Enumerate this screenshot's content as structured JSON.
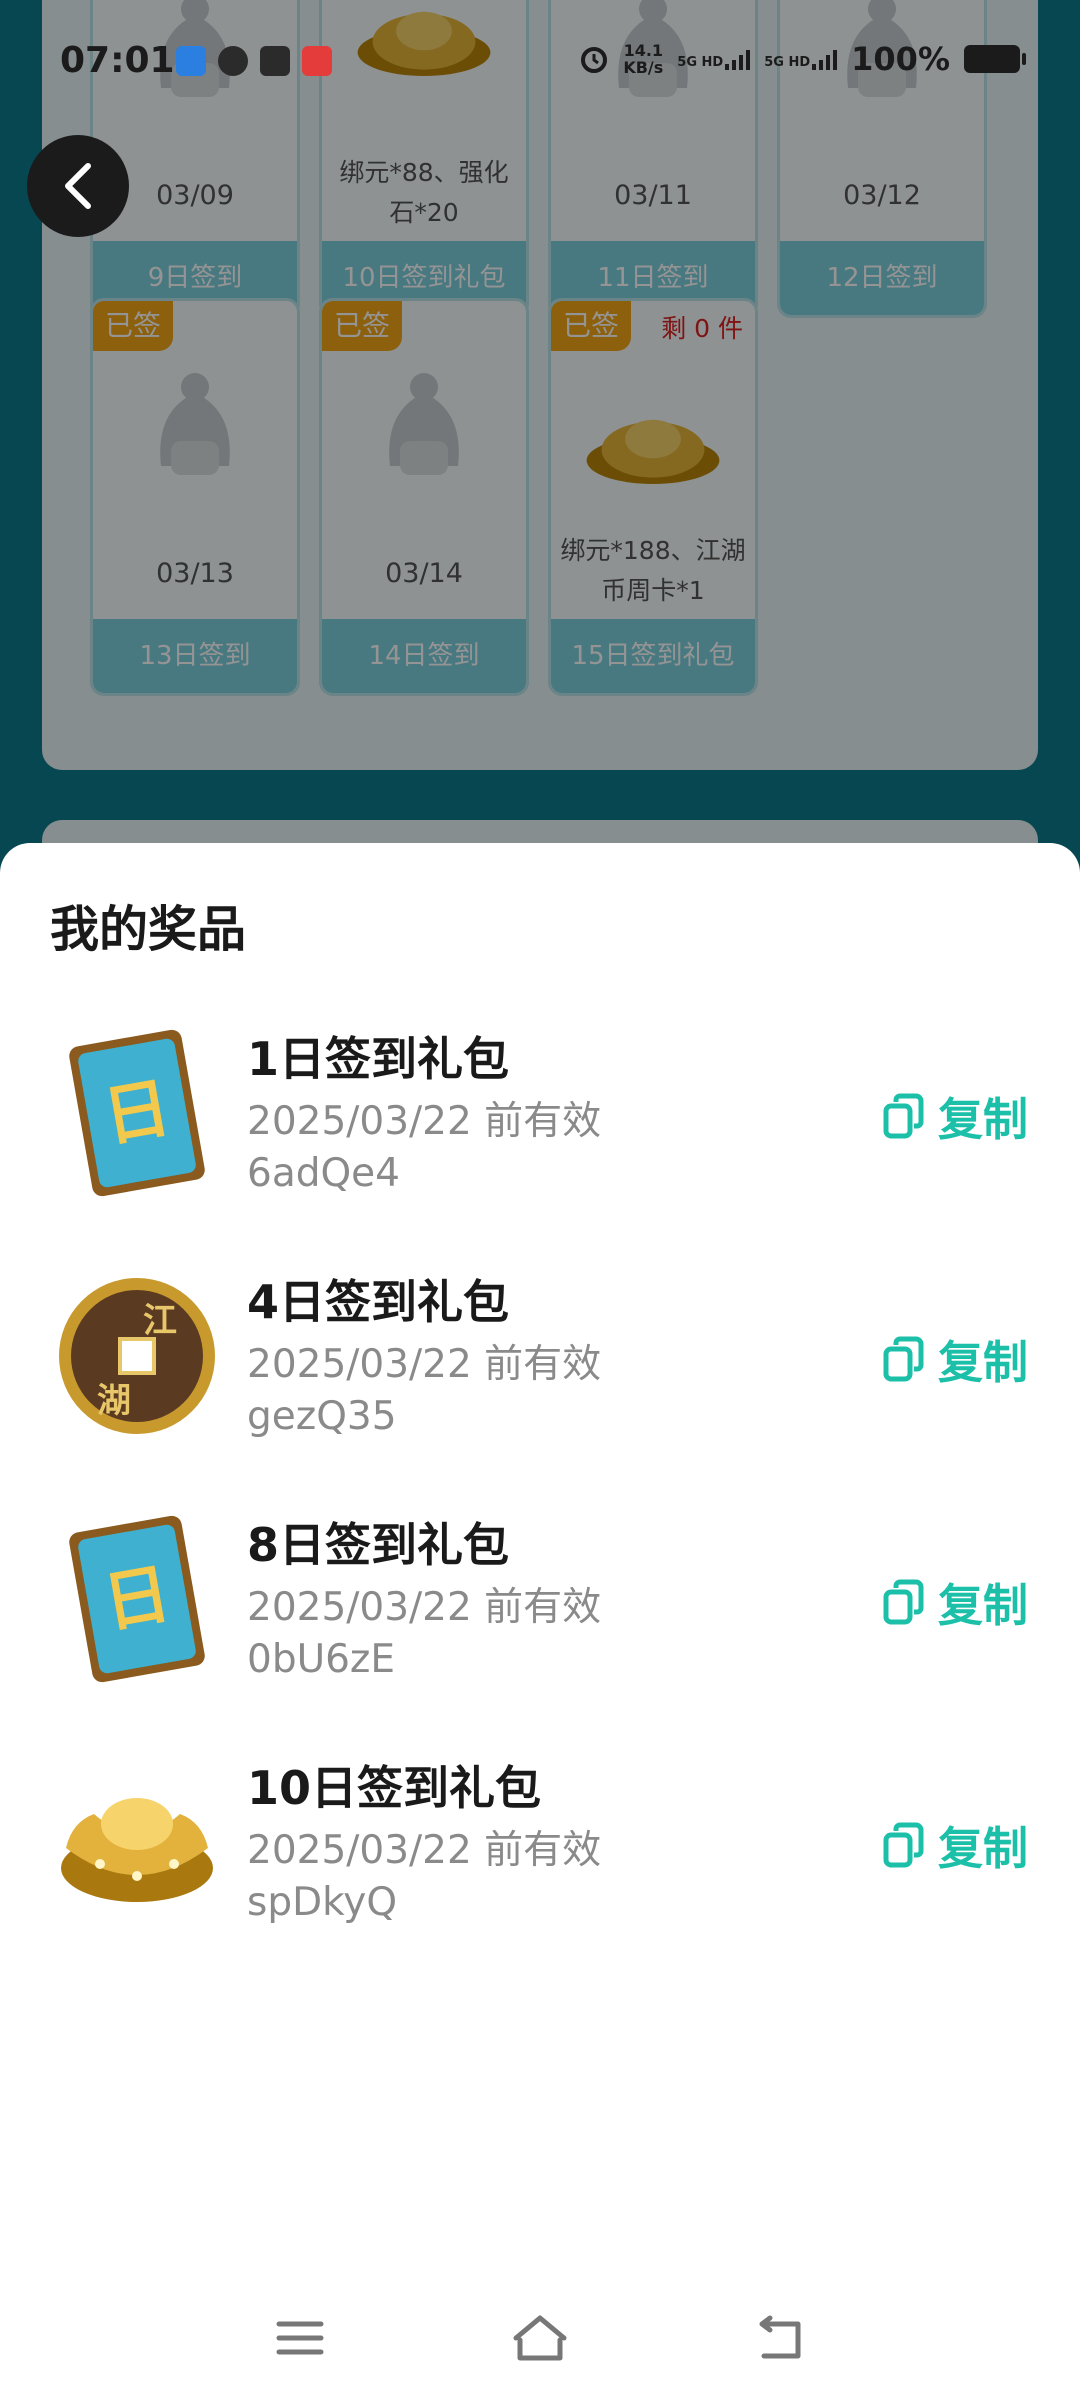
{
  "status_bar": {
    "time": "07:01",
    "net_speed_value": "14.1",
    "net_speed_unit": "KB/s",
    "sim1": "5G HD",
    "sim2": "5G HD",
    "battery": "100%"
  },
  "background": {
    "cards_row1": [
      {
        "date": "03/09",
        "desc": "",
        "label": "9日签到"
      },
      {
        "date": "",
        "desc": "绑元*88、强化石*20",
        "label": "10日签到礼包"
      },
      {
        "date": "03/11",
        "desc": "",
        "label": "11日签到"
      },
      {
        "date": "03/12",
        "desc": "",
        "label": "12日签到"
      }
    ],
    "cards_row2": [
      {
        "badge": "已签",
        "date": "03/13",
        "desc": "",
        "label": "13日签到",
        "remain": ""
      },
      {
        "badge": "已签",
        "date": "03/14",
        "desc": "",
        "label": "14日签到",
        "remain": ""
      },
      {
        "badge": "已签",
        "date": "",
        "desc": "绑元*188、江湖币周卡*1",
        "label": "15日签到礼包",
        "remain": "剩 0 件"
      }
    ]
  },
  "sheet": {
    "title": "我的奖品",
    "copy_label": "复制",
    "prizes": [
      {
        "icon": "sun-card-icon",
        "name": "1日签到礼包",
        "expiry": "2025/03/22 前有效",
        "code": "6adQe4"
      },
      {
        "icon": "jianghu-coin-icon",
        "name": "4日签到礼包",
        "expiry": "2025/03/22 前有效",
        "code": "gezQ35"
      },
      {
        "icon": "sun-card-icon",
        "name": "8日签到礼包",
        "expiry": "2025/03/22 前有效",
        "code": "0bU6zE"
      },
      {
        "icon": "gold-ingot-icon",
        "name": "10日签到礼包",
        "expiry": "2025/03/22 前有效",
        "code": "spDkyQ"
      }
    ],
    "sun_card_char": "日",
    "coin_chars": [
      "江",
      "湖"
    ]
  },
  "colors": {
    "accent": "#1cc0a9",
    "badge": "#f2a516",
    "page_bg": "#0b7a8c"
  }
}
